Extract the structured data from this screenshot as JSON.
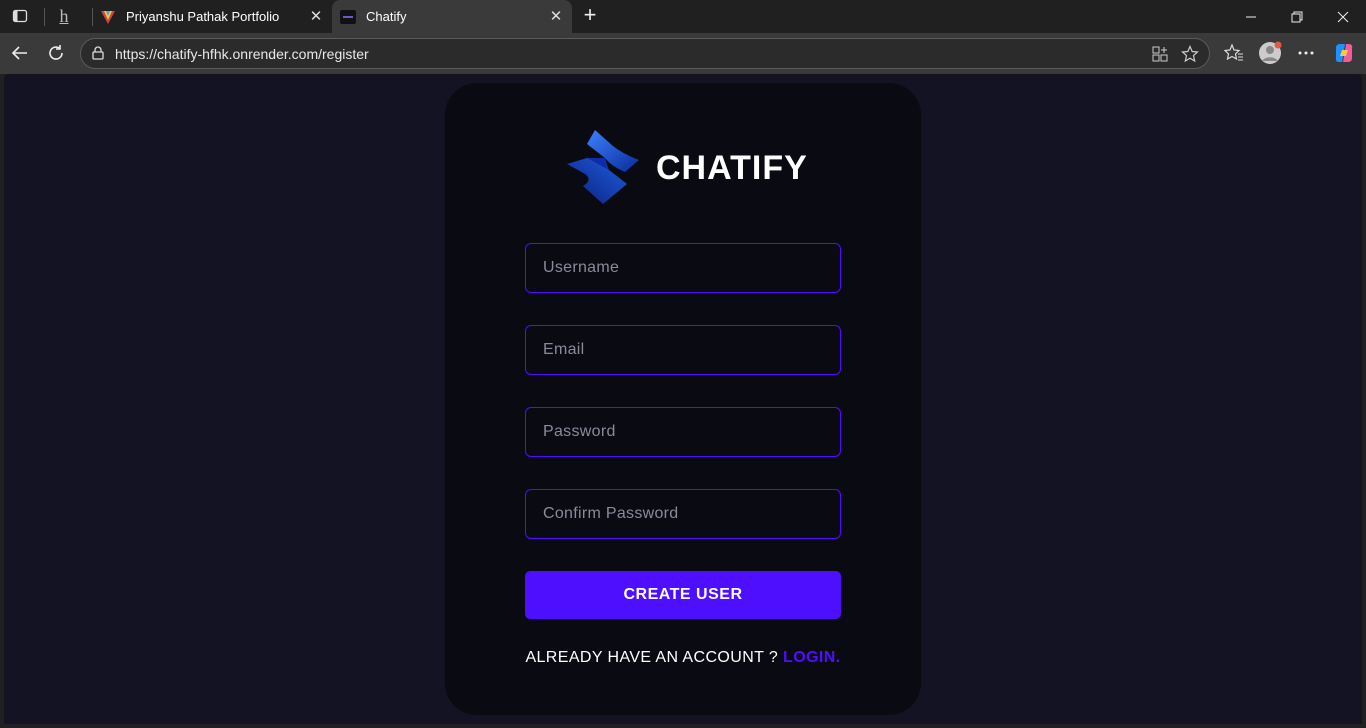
{
  "browser": {
    "tabs": [
      {
        "title": ""
      },
      {
        "title": "Priyanshu Pathak Portfolio"
      },
      {
        "title": "Chatify"
      }
    ],
    "url": "https://chatify-hfhk.onrender.com/register"
  },
  "page": {
    "brand_name": "CHATIFY",
    "fields": {
      "username_placeholder": "Username",
      "email_placeholder": "Email",
      "password_placeholder": "Password",
      "confirm_placeholder": "Confirm Password"
    },
    "submit_label": "CREATE USER",
    "footer_text": "ALREADY HAVE AN ACCOUNT ? ",
    "login_link": "LOGIN."
  },
  "colors": {
    "accent": "#4e0eff",
    "background": "#131324",
    "card": "#00000076"
  }
}
